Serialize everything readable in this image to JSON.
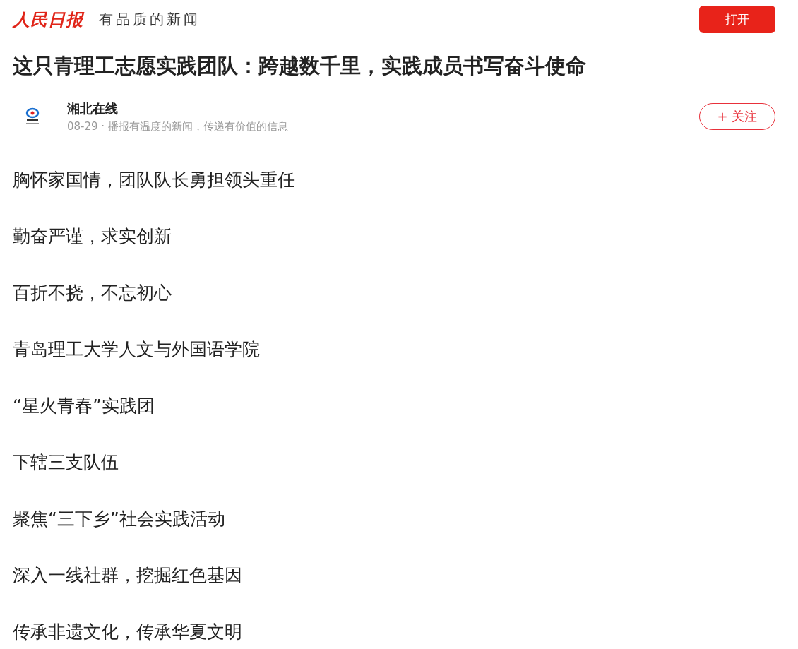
{
  "header": {
    "logo": "人民日报",
    "slogan": "有品质的新闻",
    "open_button": "打开"
  },
  "article": {
    "title": "这只青理工志愿实践团队：跨越数千里，实践成员书写奋斗使命",
    "author": {
      "name": "湘北在线",
      "date": "08-29",
      "separator": "·",
      "motto": "播报有温度的新闻，传递有价值的信息",
      "follow_button": "+ 关注"
    },
    "paragraphs": [
      "胸怀家国情，团队队长勇担领头重任",
      "勤奋严谨，求实创新",
      "百折不挠，不忘初心",
      "青岛理工大学人文与外国语学院",
      "“星火青春”实践团",
      "下辖三支队伍",
      "聚焦“三下乡”社会实践活动",
      "深入一线社群，挖掘红色基因",
      "传承非遗文化，传承华夏文明"
    ]
  }
}
